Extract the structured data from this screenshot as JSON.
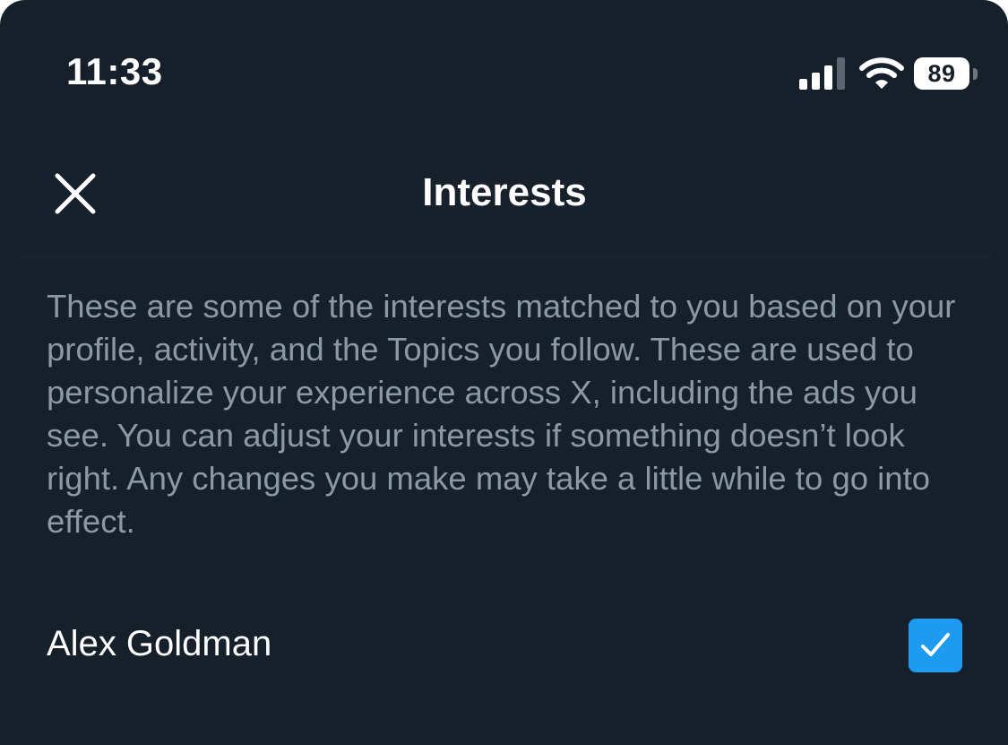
{
  "status_bar": {
    "time": "11:33",
    "battery_level": "89",
    "icons": [
      "signal-icon",
      "wifi-icon",
      "battery-icon"
    ]
  },
  "header": {
    "title": "Interests",
    "close_icon": "close-icon"
  },
  "description": "These are some of the interests matched to you based on your profile, activity, and the Topics you follow. These are used to personalize your experience across X, including the ads you see. You can adjust your interests if something doesn’t look right. Any changes you make may take a little while to go into effect.",
  "interests": [
    {
      "label": "Alex Goldman",
      "checked": true
    }
  ],
  "colors": {
    "background": "#15202b",
    "accent": "#1d9bf0",
    "secondary_text": "#8b98a5"
  }
}
